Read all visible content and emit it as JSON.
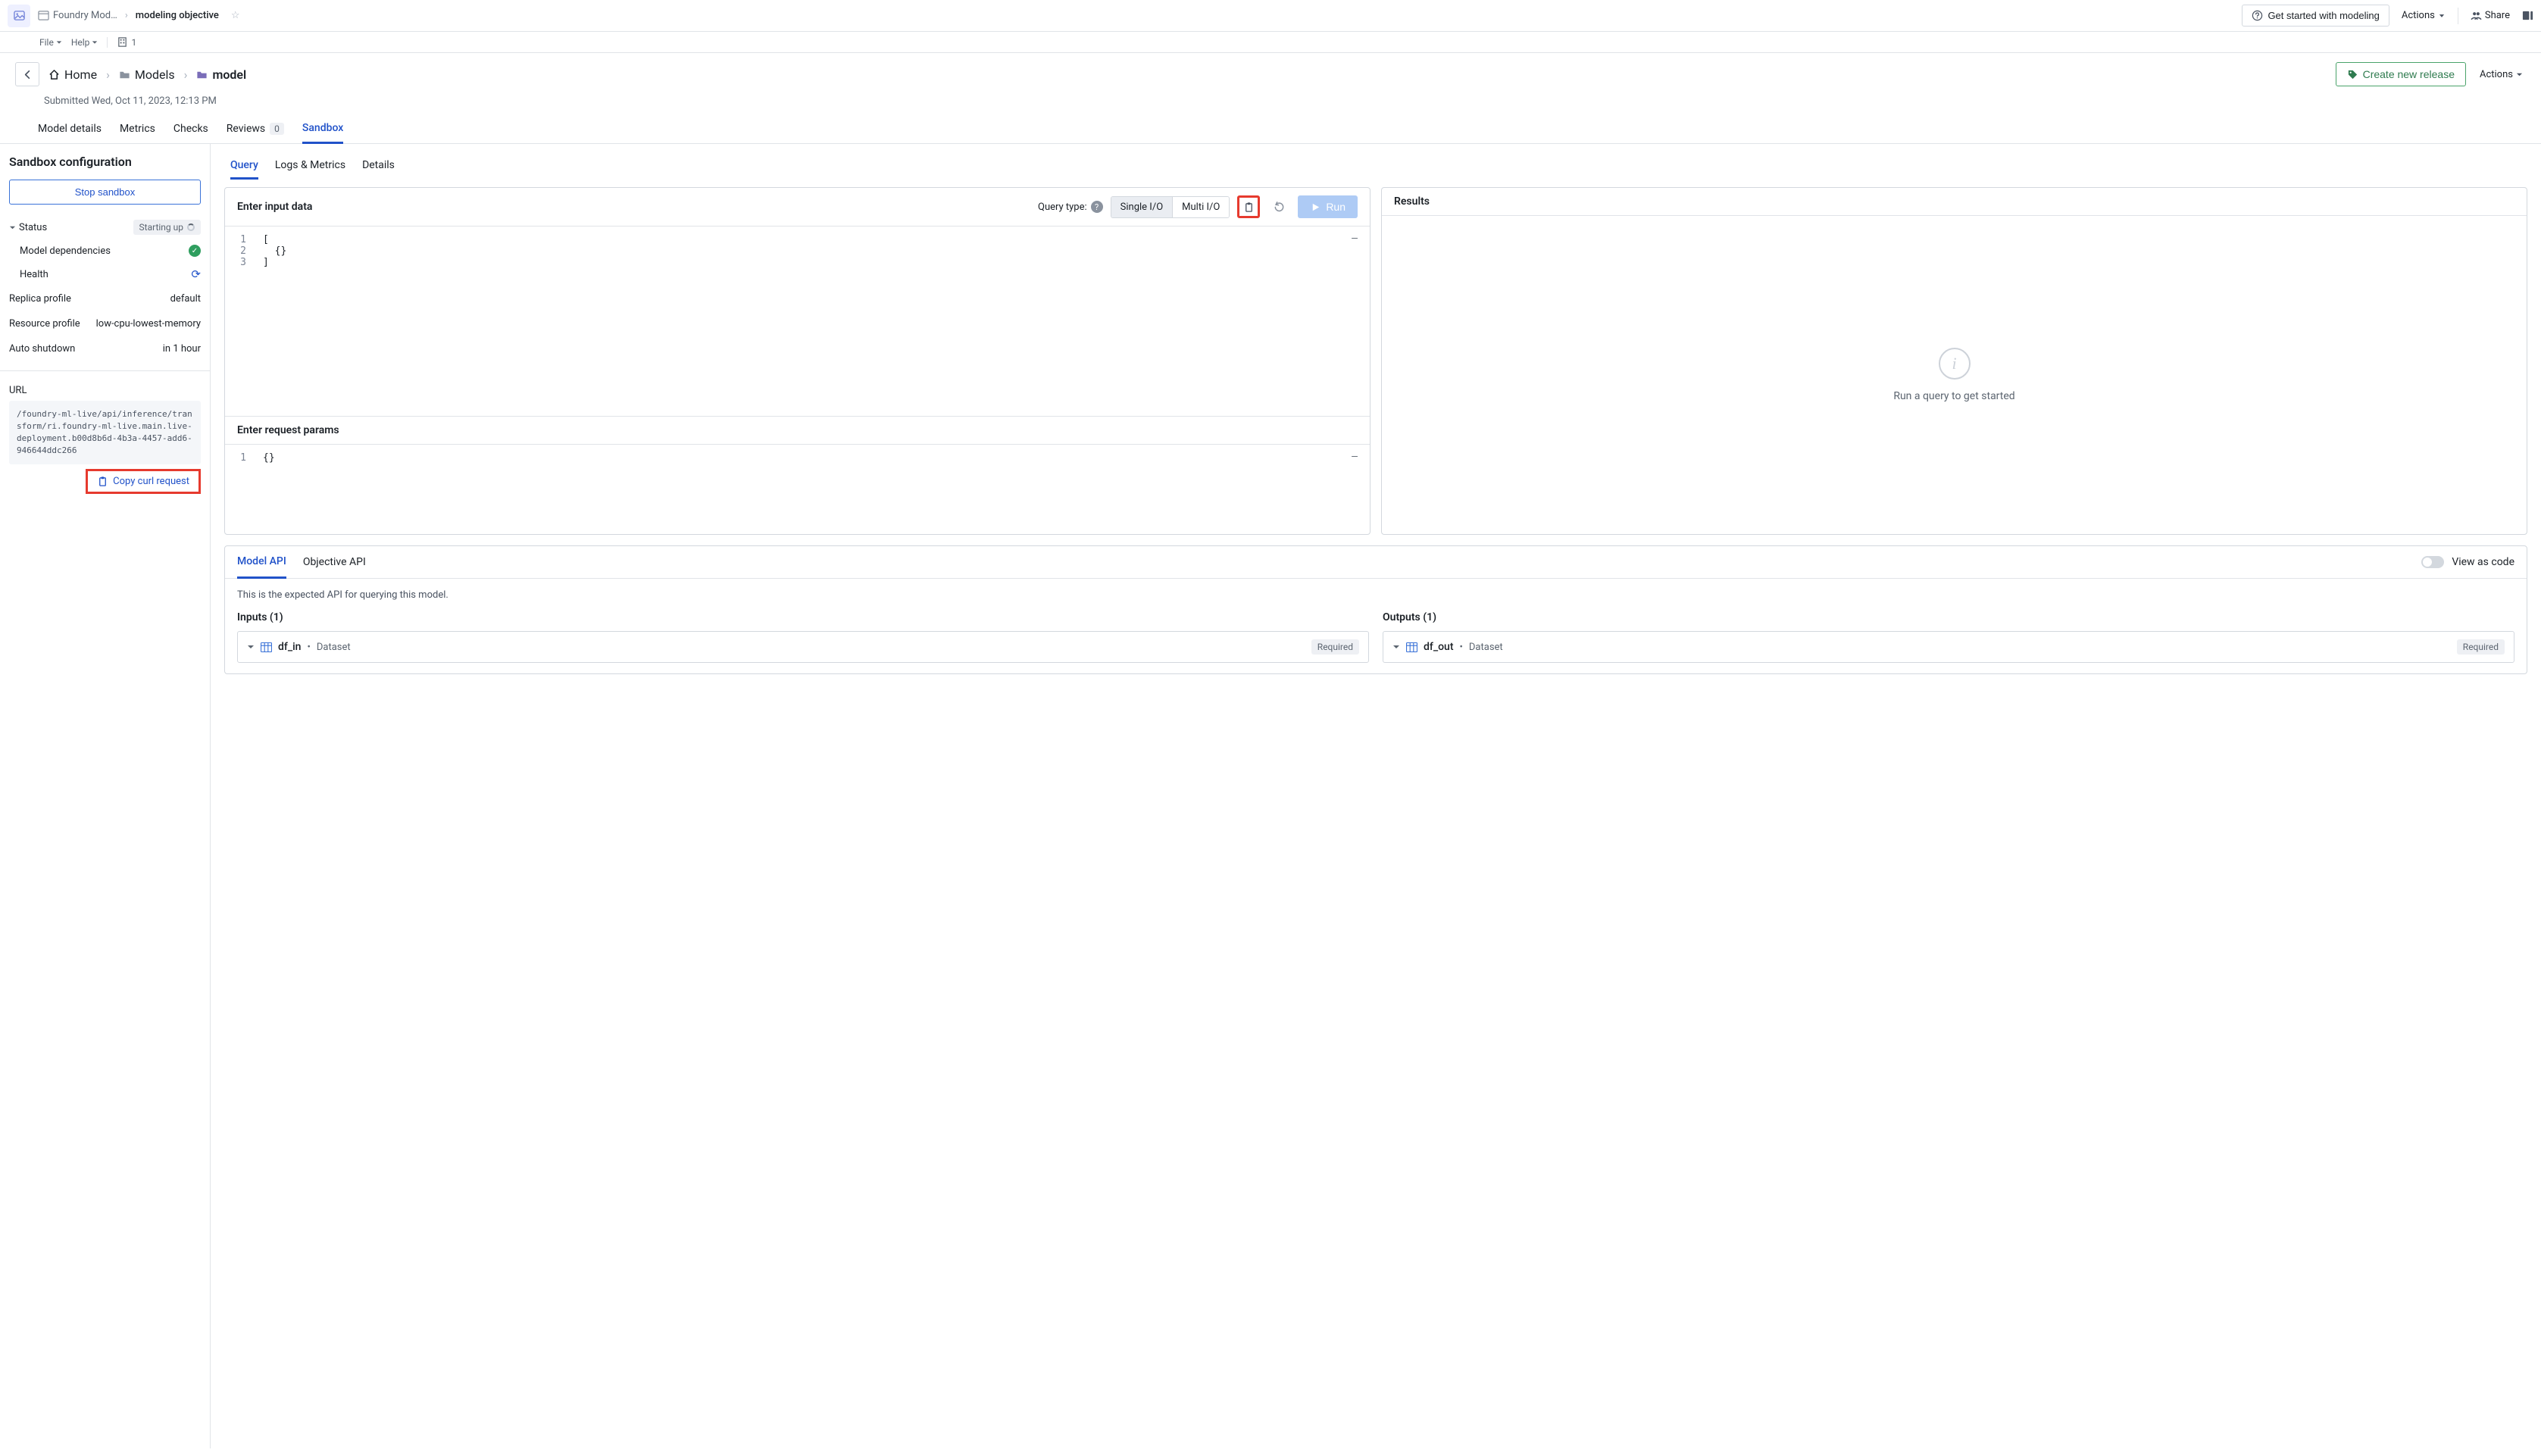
{
  "topbar": {
    "app": "Foundry Mod…",
    "page": "modeling objective",
    "getstarted": "Get started with modeling",
    "actions": "Actions",
    "share": "Share",
    "menu": {
      "file": "File",
      "help": "Help",
      "users": "1"
    }
  },
  "breadcrumbs": {
    "home": "Home",
    "models": "Models",
    "model": "model"
  },
  "submitted": "Submitted Wed, Oct 11, 2023, 12:13 PM",
  "release_btn": "Create new release",
  "actions_btn": "Actions",
  "tabs": {
    "details": "Model details",
    "metrics": "Metrics",
    "checks": "Checks",
    "reviews": "Reviews",
    "reviews_count": "0",
    "sandbox": "Sandbox"
  },
  "sidebar": {
    "title": "Sandbox configuration",
    "stop": "Stop sandbox",
    "status_label": "Status",
    "status_value": "Starting up",
    "deps_label": "Model dependencies",
    "health_label": "Health",
    "replica_label": "Replica profile",
    "replica_value": "default",
    "resource_label": "Resource profile",
    "resource_value": "low-cpu-lowest-memory",
    "shutdown_label": "Auto shutdown",
    "shutdown_value": "in 1 hour",
    "url_label": "URL",
    "url_value": "/foundry-ml-live/api/inference/transform/ri.foundry-ml-live.main.live-deployment.b00d8b6d-4b3a-4457-add6-946644ddc266",
    "copy_curl": "Copy curl request"
  },
  "subtabs": {
    "query": "Query",
    "logs": "Logs & Metrics",
    "details": "Details"
  },
  "input_panel": {
    "title": "Enter input data",
    "query_type_label": "Query type:",
    "single": "Single I/O",
    "multi": "Multi I/O",
    "run": "Run",
    "lines": [
      "[",
      "  {}",
      "]"
    ],
    "params_title": "Enter request params",
    "params_line": "{}"
  },
  "results": {
    "title": "Results",
    "placeholder": "Run a query to get started"
  },
  "api": {
    "tab_model": "Model API",
    "tab_objective": "Objective API",
    "view_code": "View as code",
    "desc": "This is the expected API for querying this model.",
    "inputs_title": "Inputs (1)",
    "outputs_title": "Outputs (1)",
    "input_name": "df_in",
    "output_name": "df_out",
    "io_type_sep": "•",
    "io_type": "Dataset",
    "required": "Required"
  }
}
